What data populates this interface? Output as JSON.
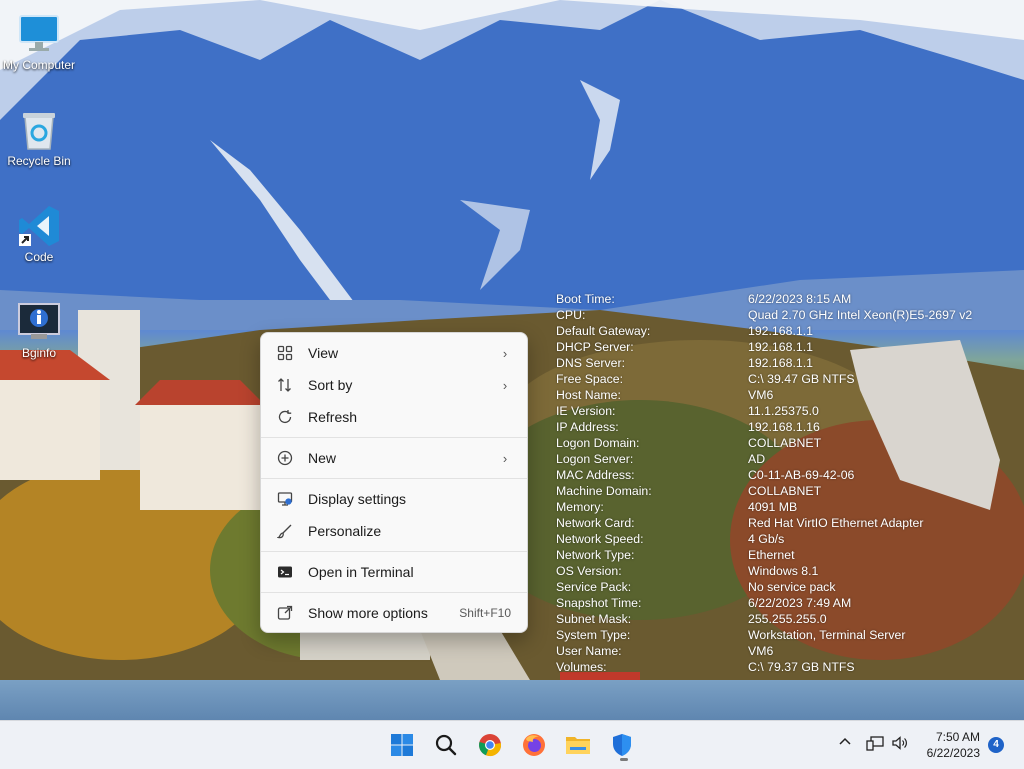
{
  "desktop_icons": [
    {
      "label": "My Computer",
      "icon": "monitor-icon"
    },
    {
      "label": "Recycle Bin",
      "icon": "recycle-bin-icon"
    },
    {
      "label": "Code",
      "icon": "vscode-icon"
    },
    {
      "label": "Bginfo",
      "icon": "bginfo-icon"
    }
  ],
  "bginfo": [
    {
      "key": "Boot Time:",
      "value": "6/22/2023 8:15 AM"
    },
    {
      "key": "CPU:",
      "value": "Quad 2.70 GHz Intel Xeon(R)E5-2697 v2"
    },
    {
      "key": "Default Gateway:",
      "value": "192.168.1.1"
    },
    {
      "key": "DHCP Server:",
      "value": "192.168.1.1"
    },
    {
      "key": "DNS Server:",
      "value": "192.168.1.1"
    },
    {
      "key": "Free Space:",
      "value": "C:\\ 39.47 GB NTFS"
    },
    {
      "key": "Host Name:",
      "value": "VM6"
    },
    {
      "key": "IE Version:",
      "value": "11.1.25375.0"
    },
    {
      "key": "IP Address:",
      "value": "192.168.1.16"
    },
    {
      "key": "Logon Domain:",
      "value": "COLLABNET"
    },
    {
      "key": "Logon Server:",
      "value": "AD"
    },
    {
      "key": "MAC Address:",
      "value": "C0-11-AB-69-42-06"
    },
    {
      "key": "Machine Domain:",
      "value": "COLLABNET"
    },
    {
      "key": "Memory:",
      "value": "4091 MB"
    },
    {
      "key": "Network Card:",
      "value": "Red Hat VirtIO Ethernet Adapter"
    },
    {
      "key": "Network Speed:",
      "value": "4 Gb/s"
    },
    {
      "key": "Network Type:",
      "value": "Ethernet"
    },
    {
      "key": "OS Version:",
      "value": "Windows 8.1"
    },
    {
      "key": "Service Pack:",
      "value": "No service pack"
    },
    {
      "key": "Snapshot Time:",
      "value": "6/22/2023 7:49 AM"
    },
    {
      "key": "Subnet Mask:",
      "value": "255.255.255.0"
    },
    {
      "key": "System Type:",
      "value": "Workstation, Terminal Server"
    },
    {
      "key": "User Name:",
      "value": "VM6"
    },
    {
      "key": "Volumes:",
      "value": "C:\\ 79.37 GB NTFS"
    }
  ],
  "context_menu": {
    "view": "View",
    "sort_by": "Sort by",
    "refresh": "Refresh",
    "new": "New",
    "display_settings": "Display settings",
    "personalize": "Personalize",
    "open_in_terminal": "Open in Terminal",
    "show_more_options": "Show more options",
    "show_more_shortcut": "Shift+F10"
  },
  "taskbar": {
    "apps": [
      "start-icon",
      "search-icon",
      "chrome-icon",
      "firefox-icon",
      "file-explorer-icon",
      "defender-icon"
    ],
    "time": "7:50 AM",
    "date": "6/22/2023",
    "notification_count": "4"
  },
  "colors": {
    "accent": "#1f63c8",
    "menu_bg": "#f9f9f9"
  }
}
